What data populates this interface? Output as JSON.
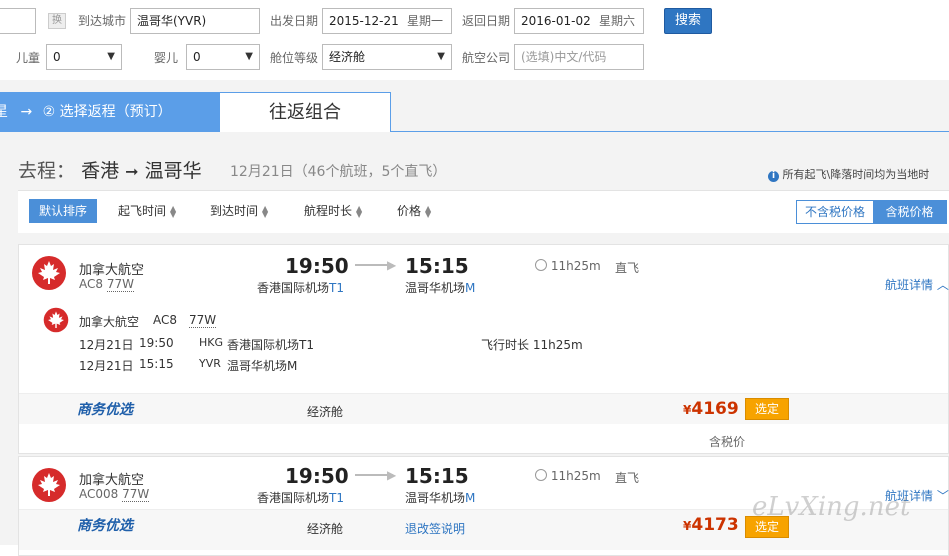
{
  "search": {
    "dest_label": "到达城市",
    "dest_value": "温哥华(YVR)",
    "swap_label": "换",
    "depart_label": "出发日期",
    "depart_date": "2015-12-21",
    "depart_weekday": "星期一",
    "return_label": "返回日期",
    "return_date": "2016-01-02",
    "return_weekday": "星期六",
    "search_button": "搜索",
    "child_label": "儿童",
    "child_value": "0",
    "infant_label": "婴儿",
    "infant_value": "0",
    "class_label": "舱位等级",
    "class_value": "经济舱",
    "airline_label": "航空公司",
    "airline_placeholder": "(选填)中文/代码"
  },
  "steps": {
    "step_left": "星",
    "arrow": "→",
    "step2": "② 选择返程（预订）",
    "combo_tab": "往返组合"
  },
  "route": {
    "prefix": "去程：",
    "from": "香港",
    "arrow": "➞",
    "to": "温哥华",
    "summary": "12月21日（46个航班，5个直飞）",
    "notice": "所有起飞\\降落时间均为当地时"
  },
  "sort": {
    "default": "默认排序",
    "depart_time": "起飞时间",
    "arrive_time": "到达时间",
    "duration": "航程时长",
    "price": "价格",
    "tax_excl": "不含税价格",
    "tax_incl": "含税价格"
  },
  "flights": [
    {
      "airline": "加拿大航空",
      "code": "AC8",
      "aircraft": "77W",
      "dep_time": "19:50",
      "dep_airport": "香港国际机场",
      "dep_terminal": "T1",
      "arr_time": "15:15",
      "arr_airport": "温哥华机场",
      "arr_terminal": "M",
      "duration": "11h25m",
      "direct": "直飞",
      "details_link": "航班详情",
      "detail": {
        "airline": "加拿大航空",
        "code": "AC8",
        "aircraft": "77W",
        "dep_date": "12月21日",
        "dep_time": "19:50",
        "dep_iata": "HKG",
        "dep_airport": "香港国际机场T1",
        "arr_date": "12月21日",
        "arr_time": "15:15",
        "arr_iata": "YVR",
        "arr_airport": "温哥华机场M",
        "flight_duration": "飞行时长 11h25m"
      },
      "brand": "商务优选",
      "cabin": "经济舱",
      "price_symbol": "¥",
      "price": "4169",
      "pick": "选定",
      "tax_note": "含税价"
    },
    {
      "airline": "加拿大航空",
      "code": "AC008",
      "aircraft": "77W",
      "dep_time": "19:50",
      "dep_airport": "香港国际机场",
      "dep_terminal": "T1",
      "arr_time": "15:15",
      "arr_airport": "温哥华机场",
      "arr_terminal": "M",
      "duration": "11h25m",
      "direct": "直飞",
      "details_link": "航班详情",
      "brand": "商务优选",
      "cabin": "经济舱",
      "change_policy": "退改签说明",
      "price_symbol": "¥",
      "price": "4173",
      "pick": "选定"
    }
  ],
  "watermark": "eLvXing.net",
  "colors": {
    "accent": "#2f76c2",
    "price": "#cc3300",
    "pick": "#f7a300",
    "aircanada": "#d62b2b"
  }
}
